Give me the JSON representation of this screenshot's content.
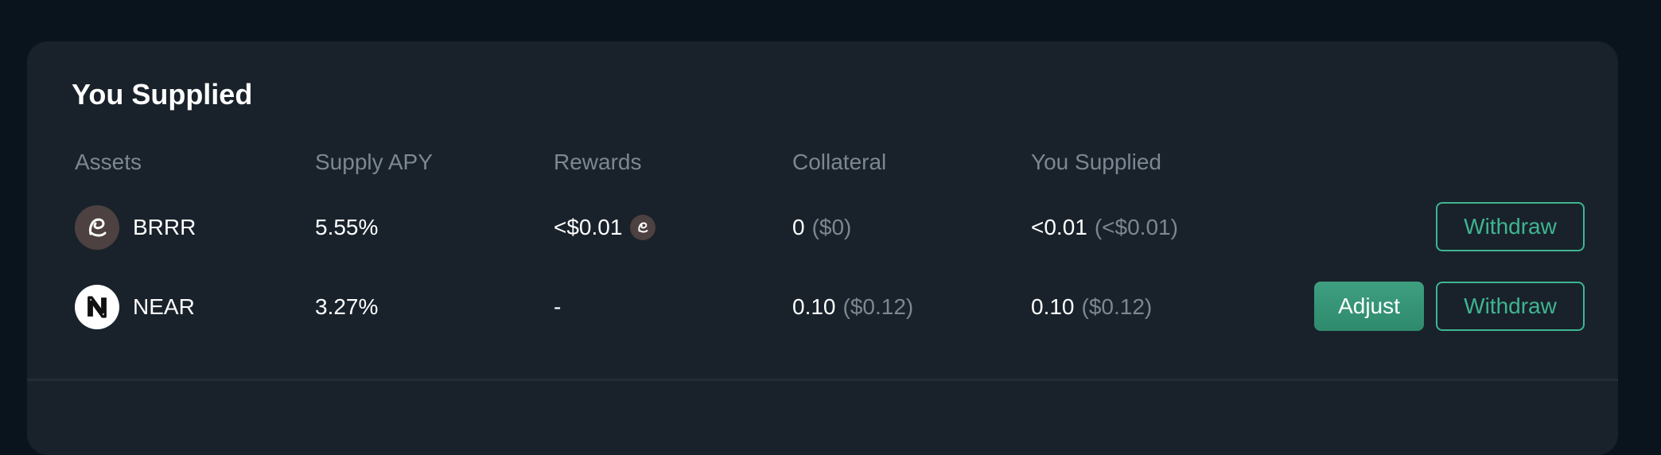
{
  "section": {
    "title": "You Supplied"
  },
  "columns": {
    "assets": "Assets",
    "supply_apy": "Supply APY",
    "rewards": "Rewards",
    "collateral": "Collateral",
    "you_supplied": "You Supplied"
  },
  "rows": [
    {
      "asset": "BRRR",
      "icon": "brrr-token-icon",
      "supply_apy": "5.55%",
      "rewards": "<$0.01",
      "reward_icon": "brrr-token-icon",
      "collateral_amount": "0",
      "collateral_usd": "($0)",
      "supplied_amount": "<0.01",
      "supplied_usd": "(<$0.01)",
      "withdraw_label": "Withdraw"
    },
    {
      "asset": "NEAR",
      "icon": "near-token-icon",
      "supply_apy": "3.27%",
      "rewards": "-",
      "collateral_amount": "0.10",
      "collateral_usd": "($0.12)",
      "supplied_amount": "0.10",
      "supplied_usd": "($0.12)",
      "adjust_label": "Adjust",
      "withdraw_label": "Withdraw"
    }
  ],
  "colors": {
    "accent": "#3fb591",
    "card_background": "#19222b",
    "page_background": "#0a141c",
    "muted_text": "#7c8791"
  }
}
